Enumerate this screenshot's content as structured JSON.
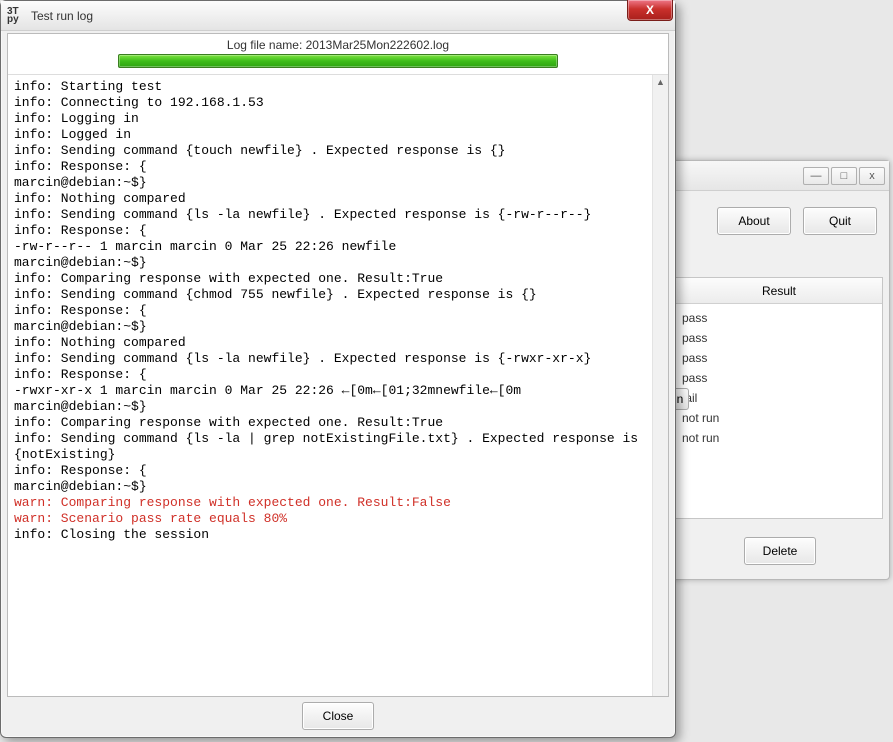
{
  "dialog": {
    "title": "Test run log",
    "icon_top": "3T",
    "icon_bottom": "py",
    "log_file_label": "Log file name: 2013Mar25Mon222602.log",
    "close_btn": "Close",
    "close_x": "X",
    "log_lines": [
      {
        "cls": "",
        "text": "info: Starting test"
      },
      {
        "cls": "",
        "text": "info: Connecting to 192.168.1.53"
      },
      {
        "cls": "",
        "text": "info: Logging in"
      },
      {
        "cls": "",
        "text": "info: Logged in"
      },
      {
        "cls": "",
        "text": "info: Sending command {touch newfile} . Expected response is {}"
      },
      {
        "cls": "",
        "text": "info: Response: {"
      },
      {
        "cls": "",
        "text": "marcin@debian:~$}"
      },
      {
        "cls": "",
        "text": "info: Nothing compared"
      },
      {
        "cls": "",
        "text": "info: Sending command {ls -la newfile} . Expected response is {-rw-r--r--}"
      },
      {
        "cls": "",
        "text": "info: Response: {"
      },
      {
        "cls": "",
        "text": "-rw-r--r-- 1 marcin marcin 0 Mar 25 22:26 newfile"
      },
      {
        "cls": "",
        "text": "marcin@debian:~$}"
      },
      {
        "cls": "",
        "text": "info: Comparing response with expected one. Result:True"
      },
      {
        "cls": "",
        "text": "info: Sending command {chmod 755 newfile} . Expected response is {}"
      },
      {
        "cls": "",
        "text": "info: Response: {"
      },
      {
        "cls": "",
        "text": "marcin@debian:~$}"
      },
      {
        "cls": "",
        "text": "info: Nothing compared"
      },
      {
        "cls": "",
        "text": "info: Sending command {ls -la newfile} . Expected response is {-rwxr-xr-x}"
      },
      {
        "cls": "",
        "text": "info: Response: {"
      },
      {
        "cls": "",
        "text": "-rwxr-xr-x 1 marcin marcin 0 Mar 25 22:26 ←[0m←[01;32mnewfile←[0m"
      },
      {
        "cls": "",
        "text": "marcin@debian:~$}"
      },
      {
        "cls": "",
        "text": "info: Comparing response with expected one. Result:True"
      },
      {
        "cls": "",
        "text": "info: Sending command {ls -la | grep notExistingFile.txt} . Expected response is {notExisting}"
      },
      {
        "cls": "",
        "text": "info: Response: {"
      },
      {
        "cls": "",
        "text": "marcin@debian:~$}"
      },
      {
        "cls": "warn",
        "text": "warn: Comparing response with expected one. Result:False"
      },
      {
        "cls": "warn",
        "text": "warn: Scenario pass rate equals 80%"
      },
      {
        "cls": "",
        "text": "info: Closing the session"
      }
    ]
  },
  "bg": {
    "min_glyph": "—",
    "max_glyph": "□",
    "close_glyph": "x",
    "about_btn": "About",
    "quit_btn": "Quit",
    "tab_btn": "n",
    "result_header": "Result",
    "delete_btn": "Delete",
    "results": [
      "pass",
      "pass",
      "pass",
      "pass",
      "fail",
      "not run",
      "not run"
    ]
  }
}
